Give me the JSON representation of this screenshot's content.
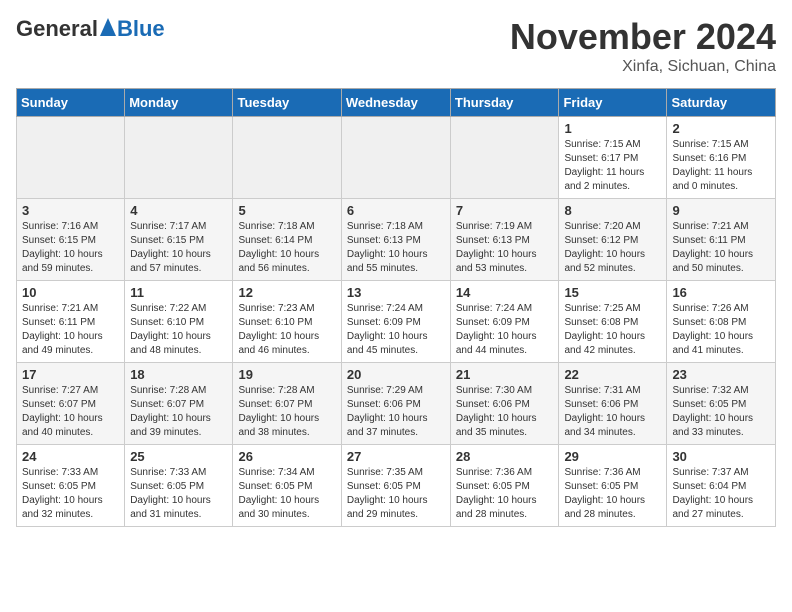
{
  "header": {
    "logo_general": "General",
    "logo_blue": "Blue",
    "title": "November 2024",
    "subtitle": "Xinfa, Sichuan, China"
  },
  "weekdays": [
    "Sunday",
    "Monday",
    "Tuesday",
    "Wednesday",
    "Thursday",
    "Friday",
    "Saturday"
  ],
  "weeks": [
    [
      {
        "day": "",
        "info": ""
      },
      {
        "day": "",
        "info": ""
      },
      {
        "day": "",
        "info": ""
      },
      {
        "day": "",
        "info": ""
      },
      {
        "day": "",
        "info": ""
      },
      {
        "day": "1",
        "info": "Sunrise: 7:15 AM\nSunset: 6:17 PM\nDaylight: 11 hours and 2 minutes."
      },
      {
        "day": "2",
        "info": "Sunrise: 7:15 AM\nSunset: 6:16 PM\nDaylight: 11 hours and 0 minutes."
      }
    ],
    [
      {
        "day": "3",
        "info": "Sunrise: 7:16 AM\nSunset: 6:15 PM\nDaylight: 10 hours and 59 minutes."
      },
      {
        "day": "4",
        "info": "Sunrise: 7:17 AM\nSunset: 6:15 PM\nDaylight: 10 hours and 57 minutes."
      },
      {
        "day": "5",
        "info": "Sunrise: 7:18 AM\nSunset: 6:14 PM\nDaylight: 10 hours and 56 minutes."
      },
      {
        "day": "6",
        "info": "Sunrise: 7:18 AM\nSunset: 6:13 PM\nDaylight: 10 hours and 55 minutes."
      },
      {
        "day": "7",
        "info": "Sunrise: 7:19 AM\nSunset: 6:13 PM\nDaylight: 10 hours and 53 minutes."
      },
      {
        "day": "8",
        "info": "Sunrise: 7:20 AM\nSunset: 6:12 PM\nDaylight: 10 hours and 52 minutes."
      },
      {
        "day": "9",
        "info": "Sunrise: 7:21 AM\nSunset: 6:11 PM\nDaylight: 10 hours and 50 minutes."
      }
    ],
    [
      {
        "day": "10",
        "info": "Sunrise: 7:21 AM\nSunset: 6:11 PM\nDaylight: 10 hours and 49 minutes."
      },
      {
        "day": "11",
        "info": "Sunrise: 7:22 AM\nSunset: 6:10 PM\nDaylight: 10 hours and 48 minutes."
      },
      {
        "day": "12",
        "info": "Sunrise: 7:23 AM\nSunset: 6:10 PM\nDaylight: 10 hours and 46 minutes."
      },
      {
        "day": "13",
        "info": "Sunrise: 7:24 AM\nSunset: 6:09 PM\nDaylight: 10 hours and 45 minutes."
      },
      {
        "day": "14",
        "info": "Sunrise: 7:24 AM\nSunset: 6:09 PM\nDaylight: 10 hours and 44 minutes."
      },
      {
        "day": "15",
        "info": "Sunrise: 7:25 AM\nSunset: 6:08 PM\nDaylight: 10 hours and 42 minutes."
      },
      {
        "day": "16",
        "info": "Sunrise: 7:26 AM\nSunset: 6:08 PM\nDaylight: 10 hours and 41 minutes."
      }
    ],
    [
      {
        "day": "17",
        "info": "Sunrise: 7:27 AM\nSunset: 6:07 PM\nDaylight: 10 hours and 40 minutes."
      },
      {
        "day": "18",
        "info": "Sunrise: 7:28 AM\nSunset: 6:07 PM\nDaylight: 10 hours and 39 minutes."
      },
      {
        "day": "19",
        "info": "Sunrise: 7:28 AM\nSunset: 6:07 PM\nDaylight: 10 hours and 38 minutes."
      },
      {
        "day": "20",
        "info": "Sunrise: 7:29 AM\nSunset: 6:06 PM\nDaylight: 10 hours and 37 minutes."
      },
      {
        "day": "21",
        "info": "Sunrise: 7:30 AM\nSunset: 6:06 PM\nDaylight: 10 hours and 35 minutes."
      },
      {
        "day": "22",
        "info": "Sunrise: 7:31 AM\nSunset: 6:06 PM\nDaylight: 10 hours and 34 minutes."
      },
      {
        "day": "23",
        "info": "Sunrise: 7:32 AM\nSunset: 6:05 PM\nDaylight: 10 hours and 33 minutes."
      }
    ],
    [
      {
        "day": "24",
        "info": "Sunrise: 7:33 AM\nSunset: 6:05 PM\nDaylight: 10 hours and 32 minutes."
      },
      {
        "day": "25",
        "info": "Sunrise: 7:33 AM\nSunset: 6:05 PM\nDaylight: 10 hours and 31 minutes."
      },
      {
        "day": "26",
        "info": "Sunrise: 7:34 AM\nSunset: 6:05 PM\nDaylight: 10 hours and 30 minutes."
      },
      {
        "day": "27",
        "info": "Sunrise: 7:35 AM\nSunset: 6:05 PM\nDaylight: 10 hours and 29 minutes."
      },
      {
        "day": "28",
        "info": "Sunrise: 7:36 AM\nSunset: 6:05 PM\nDaylight: 10 hours and 28 minutes."
      },
      {
        "day": "29",
        "info": "Sunrise: 7:36 AM\nSunset: 6:05 PM\nDaylight: 10 hours and 28 minutes."
      },
      {
        "day": "30",
        "info": "Sunrise: 7:37 AM\nSunset: 6:04 PM\nDaylight: 10 hours and 27 minutes."
      }
    ]
  ]
}
